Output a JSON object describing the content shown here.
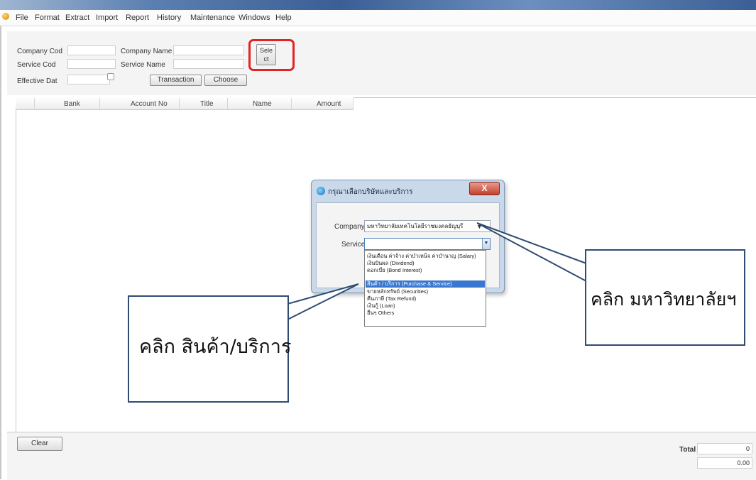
{
  "menu": {
    "items": [
      "File",
      "Format",
      "Extract",
      "Import",
      "Report",
      "History",
      "Maintenance",
      "Windows",
      "Help"
    ]
  },
  "form": {
    "company_code_label": "Company Cod",
    "company_name_label": "Company Name",
    "service_code_label": "Service Cod",
    "service_name_label": "Service Name",
    "effective_date_label": "Effective Dat",
    "select_label_1": "Sele",
    "select_label_2": "ct",
    "transaction_label": "Transaction",
    "choose_label": "Choose"
  },
  "grid": {
    "columns": [
      "Bank",
      "Account No",
      "Title",
      "Name",
      "Amount"
    ]
  },
  "footer": {
    "clear_label": "Clear",
    "total_label": "Total",
    "total_count": "0",
    "total_amount": "0.00"
  },
  "dialog": {
    "title": "กรุณาเลือกบริษัทและบริการ",
    "close_label": "X",
    "company_label": "Company",
    "company_value": "มหาวิทยาลัยเทคโนโลยีราชมงคลธัญบุรี",
    "service_label": "Service",
    "service_value": "",
    "service_options": [
      "เงินเดือน ค่าจ้าง ค่าบำเหน็จ ค่าบำนาญ (Salary)",
      "เงินปันผล (Dividend)",
      "ดอกเบี้ย (Bond Interest)",
      "สินค้า / บริการ (Purchase & Service)",
      "ขายหลักทรัพย์ (Securities)",
      "คืนภาษี (Tax Refund)",
      "เงินกู้ (Loan)",
      "อื่นๆ Others"
    ],
    "selected_index": 3
  },
  "callouts": {
    "left": "คลิก สินค้า/บริการ",
    "right": "คลิก มหาวิทยาลัยฯ"
  },
  "colors": {
    "highlight_red": "#e32222",
    "selection_blue": "#3a78d0",
    "callout_border": "#2f4c72"
  }
}
